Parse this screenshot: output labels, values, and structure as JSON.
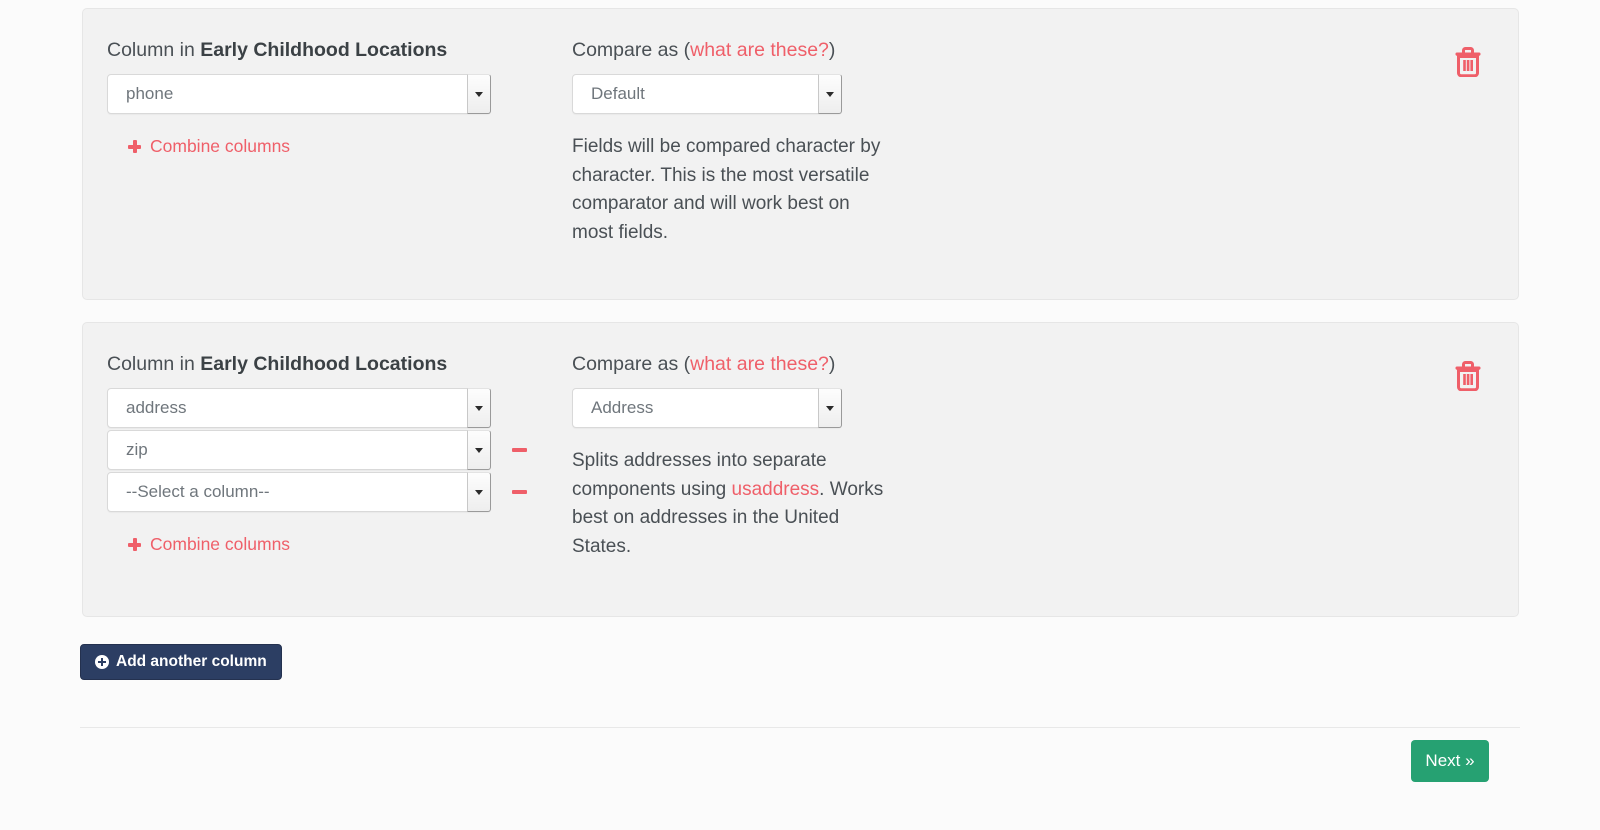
{
  "cards": [
    {
      "left_label_prefix": "Column in ",
      "left_label_dataset": "Early Childhood Locations",
      "compare_label_prefix": "Compare as (",
      "compare_label_link": "what are these?",
      "compare_label_suffix": ")",
      "column_selects": [
        {
          "value": "phone"
        }
      ],
      "combine_label": "Combine columns",
      "comparator_value": "Default",
      "help_text": "Fields will be compared character by character. This is the most versatile comparator and will work best on most fields.",
      "delete_icon": "trash-icon"
    },
    {
      "left_label_prefix": "Column in ",
      "left_label_dataset": "Early Childhood Locations",
      "compare_label_prefix": "Compare as (",
      "compare_label_link": "what are these?",
      "compare_label_suffix": ")",
      "column_selects": [
        {
          "value": "address"
        },
        {
          "value": "zip"
        },
        {
          "value": "--Select a column--"
        }
      ],
      "combine_label": "Combine columns",
      "comparator_value": "Address",
      "help_text_before_link": "Splits addresses into separate components using ",
      "help_link": "usaddress",
      "help_text_after_link": ". Works best on addresses in the United States.",
      "delete_icon": "trash-icon"
    }
  ],
  "add_button": {
    "label": "Add another column",
    "icon": "circle-plus-icon"
  },
  "next_button": {
    "label": "Next »"
  },
  "colors": {
    "accent_red": "#ef5f69",
    "navy": "#2c3e63",
    "green": "#26a172",
    "card_bg": "#f2f2f2",
    "page_bg": "#fbfbfb",
    "text": "#4a5055"
  }
}
